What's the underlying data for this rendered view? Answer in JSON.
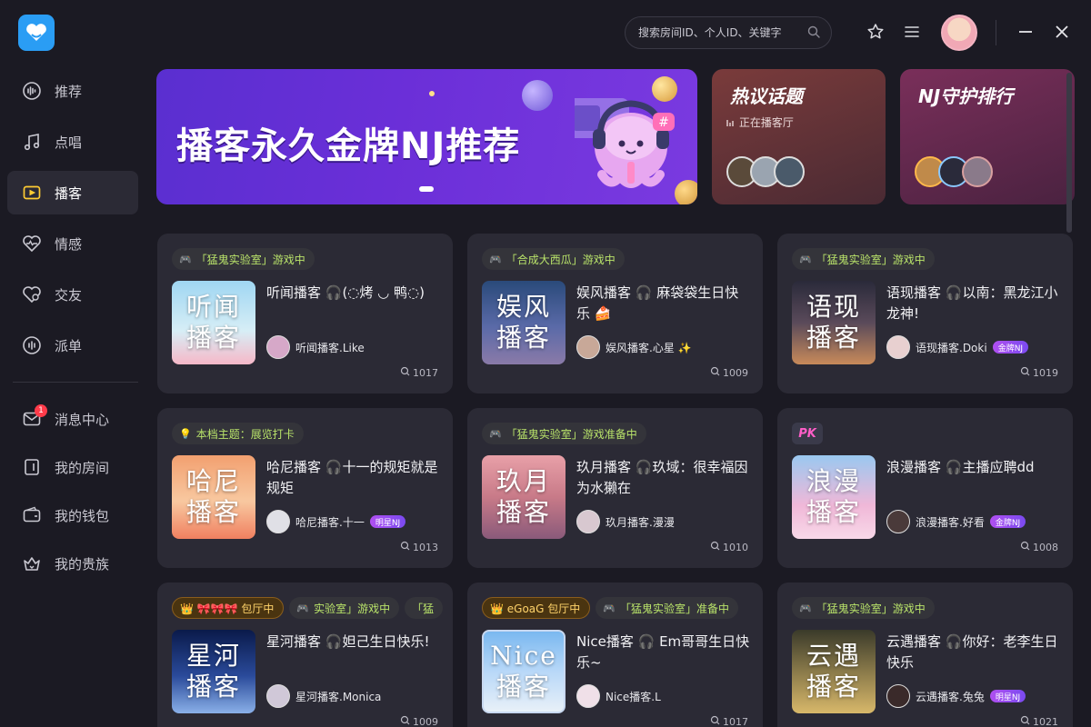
{
  "sidebar": {
    "items": [
      {
        "label": "推荐",
        "icon": "waveform-icon"
      },
      {
        "label": "点唱",
        "icon": "music-note-icon"
      },
      {
        "label": "播客",
        "icon": "podcast-play-icon",
        "active": true
      },
      {
        "label": "情感",
        "icon": "heartbeat-icon"
      },
      {
        "label": "交友",
        "icon": "heart-icon"
      },
      {
        "label": "派单",
        "icon": "bars-circle-icon"
      }
    ],
    "secondary": [
      {
        "label": "消息中心",
        "icon": "message-icon",
        "badge": "1"
      },
      {
        "label": "我的房间",
        "icon": "door-icon"
      },
      {
        "label": "我的钱包",
        "icon": "wallet-icon"
      },
      {
        "label": "我的贵族",
        "icon": "crown-icon"
      }
    ]
  },
  "topbar": {
    "search_placeholder": "搜索房间ID、个人ID、关键字"
  },
  "banners": {
    "hero_title": "播客永久金牌NJ推荐",
    "topics_title": "热议话题",
    "topics_sub": "正在播客厅",
    "ranking_title": "NJ守护排行"
  },
  "rooms": [
    {
      "tags": [
        {
          "text": "「猛鬼实验室」游戏中"
        }
      ],
      "cover": [
        "听闻",
        "播客"
      ],
      "title": "听闻播客 🎧(◌烤 ◡ 鸭◌)",
      "host": "听闻播客.Like",
      "nj": "",
      "count": "1017"
    },
    {
      "tags": [
        {
          "text": "「合成大西瓜」游戏中"
        }
      ],
      "cover": [
        "娱风",
        "播客"
      ],
      "title": "娱风播客 🎧 麻袋袋生日快乐 🍰",
      "host": "娱风播客.心星 ✨",
      "nj": "",
      "count": "1009"
    },
    {
      "tags": [
        {
          "text": "「猛鬼实验室」游戏中"
        }
      ],
      "cover": [
        "语现",
        "播客"
      ],
      "title": "语现播客 🎧以南：黑龙江小龙神!",
      "host": "语现播客.Doki",
      "nj": "金牌NJ",
      "count": "1019"
    },
    {
      "tags": [
        {
          "text": "本档主题：展览打卡"
        }
      ],
      "cover": [
        "哈尼",
        "播客"
      ],
      "title": "哈尼播客 🎧十一的规矩就是规矩",
      "host": "哈尼播客.十一",
      "nj": "明星NJ",
      "count": "1013"
    },
    {
      "tags": [
        {
          "text": "「猛鬼实验室」游戏准备中"
        }
      ],
      "cover": [
        "玖月",
        "播客"
      ],
      "title": "玖月播客 🎧玖域：很幸福因为水獭在",
      "host": "玖月播客.漫漫",
      "nj": "",
      "count": "1010"
    },
    {
      "tags": [
        {
          "text": "PK",
          "pk": true
        }
      ],
      "cover": [
        "浪漫",
        "播客"
      ],
      "title": "浪漫播客 🎧主播应聘dd",
      "host": "浪漫播客.好看",
      "nj": "金牌NJ",
      "count": "1008"
    },
    {
      "tags": [
        {
          "text": "👑 🎀🎀🎀 包厅中",
          "gold": true
        },
        {
          "text": "实验室」游戏中"
        },
        {
          "text": "「猛"
        }
      ],
      "cover": [
        "星河",
        "播客"
      ],
      "title": "星河播客 🎧妲己生日快乐!",
      "host": "星河播客.Monica",
      "nj": "",
      "count": "1009"
    },
    {
      "tags": [
        {
          "text": "👑 eGoaG 包厅中",
          "gold": true
        },
        {
          "text": "「猛鬼实验室」准备中"
        }
      ],
      "cover": [
        "Nice",
        "播客"
      ],
      "title": "Nice播客 🎧 Em哥哥生日快乐~",
      "host": "Nice播客.L",
      "nj": "",
      "count": "1017"
    },
    {
      "tags": [
        {
          "text": "「猛鬼实验室」游戏中"
        }
      ],
      "cover": [
        "云遇",
        "播客"
      ],
      "title": "云遇播客 🎧你好：老李生日快乐",
      "host": "云遇播客.兔兔",
      "nj": "明星NJ",
      "count": "1021"
    }
  ],
  "colors": {
    "background": "#1b1a23",
    "card": "#2b2a35",
    "accent": "#ffcc33",
    "tag_text": "#b9e36a",
    "hero": "#6b2fd8"
  }
}
